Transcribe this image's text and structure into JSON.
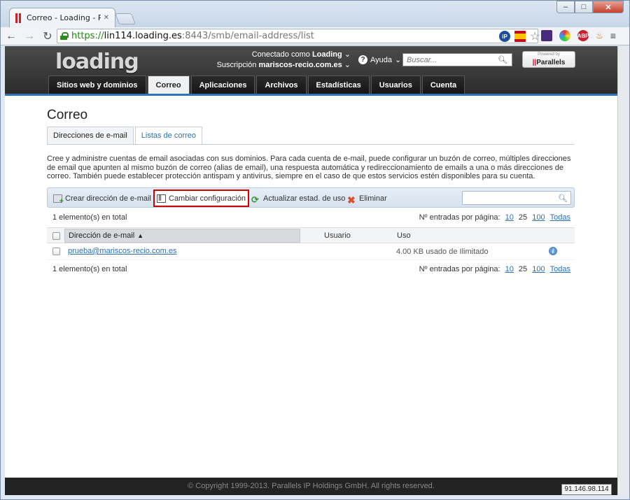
{
  "browser": {
    "tab_title": "Correo - Loading - Panel c",
    "url_scheme": "https://",
    "url_host": "lin114.loading.es",
    "url_rest": ":8443/smb/email-address/list"
  },
  "header": {
    "logo": "loading",
    "connected_label": "Conectado como",
    "connected_user": "Loading",
    "subscription_label": "Suscripción",
    "subscription_value": "mariscos-recio.com.es",
    "help": "Ayuda",
    "search_placeholder": "Buscar...",
    "powered_by": "Powered by",
    "parallels": "Parallels"
  },
  "nav": {
    "items": [
      "Sitios web y dominios",
      "Correo",
      "Aplicaciones",
      "Archivos",
      "Estadísticas",
      "Usuarios",
      "Cuenta"
    ]
  },
  "page": {
    "title": "Correo",
    "tab_addresses": "Direcciones de e-mail",
    "tab_lists": "Listas de correo",
    "description": "Cree y administre cuentas de email asociadas con sus dominios. Para cada cuenta de e-mail, puede configurar un buzón de correo, múltiples direcciones de email que apunten al mismo buzón de correo (alias de email), una respuesta automática y redireccionamiento de emails a una o más direcciones de correo. También puede establecer protección antispam y antivirus, siempre en el caso de que estos servicios estén disponibles para su cuenta."
  },
  "actions": {
    "create": "Crear dirección de e-mail",
    "change": "Cambiar configuración",
    "update": "Actualizar estad. de uso",
    "delete": "Eliminar"
  },
  "list": {
    "total": "1 elemento(s) en total",
    "per_page_label": "Nº entradas por página:",
    "per_page_10": "10",
    "per_page_25": "25",
    "per_page_100": "100",
    "per_page_all": "Todas",
    "col_email": "Dirección de e-mail",
    "col_user": "Usuario",
    "col_use": "Uso",
    "rows": [
      {
        "email": "prueba@mariscos-recio.com.es",
        "usage": "4.00 KB usado de Ilimitado"
      }
    ]
  },
  "footer": {
    "copyright": "© Copyright 1999-2013. Parallels IP Holdings GmbH. All rights reserved.",
    "ip": "91.146.98.114"
  }
}
